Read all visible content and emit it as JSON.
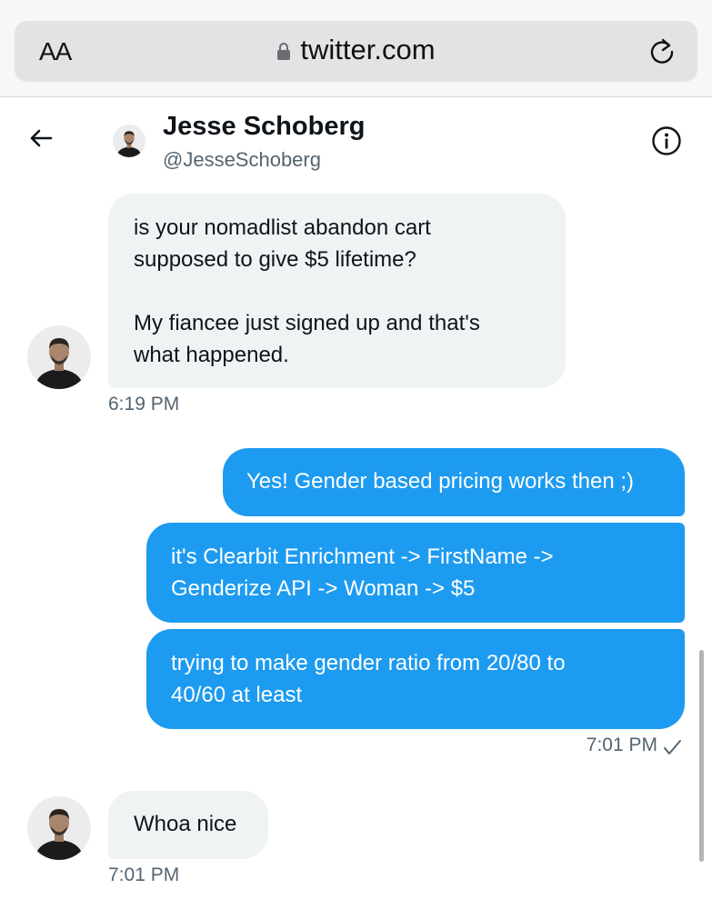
{
  "browser": {
    "text_size_label": "AA",
    "url": "twitter.com",
    "lock_icon": "lock-icon",
    "reload_icon": "reload-icon"
  },
  "header": {
    "back_icon": "arrow-left-icon",
    "name": "Jesse Schoberg",
    "handle": "@JesseSchoberg",
    "info_icon": "info-icon"
  },
  "messages": [
    {
      "direction": "incoming",
      "lines": [
        "is your nomadlist abandon cart",
        "supposed to give $5 lifetime?",
        "",
        "My fiancee just signed up and that's",
        "what happened."
      ],
      "time": "6:19 PM"
    },
    {
      "direction": "outgoing",
      "text": "Yes! Gender based pricing works then ;)"
    },
    {
      "direction": "outgoing",
      "lines": [
        "it's Clearbit Enrichment -> FirstName ->",
        "Genderize API -> Woman -> $5"
      ]
    },
    {
      "direction": "outgoing",
      "lines": [
        "trying to make gender ratio from 20/80 to",
        "40/60 at least"
      ],
      "time": "7:01 PM",
      "status_icon": "checkmark-icon"
    },
    {
      "direction": "incoming",
      "text": "Whoa nice",
      "time": "7:01 PM"
    }
  ],
  "colors": {
    "outgoing_bubble": "#1d9bf0",
    "incoming_bubble": "#eff3f4",
    "secondary_text": "#536471"
  }
}
